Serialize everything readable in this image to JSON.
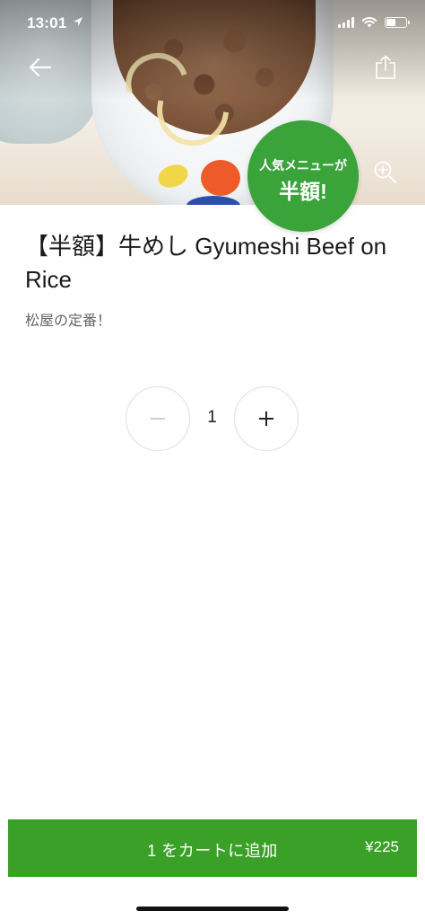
{
  "status_bar": {
    "time": "13:01"
  },
  "item": {
    "title": "【半額】牛めし Gyumeshi Beef on Rice",
    "description": "松屋の定番！",
    "promo_badge": {
      "line1": "人気メニューが",
      "line2": "半額!"
    },
    "image_icon": "food-photo"
  },
  "quantity": {
    "value": "1",
    "minus_icon": "minus-icon",
    "plus_icon": "plus-icon"
  },
  "cart_button": {
    "label": "1 をカートに追加",
    "price": "¥225"
  },
  "icons": {
    "back": "back-arrow-icon",
    "share": "share-icon",
    "zoom": "zoom-in-icon"
  },
  "colors": {
    "accent_green": "#3aa028",
    "badge_green": "#3aa33a"
  }
}
